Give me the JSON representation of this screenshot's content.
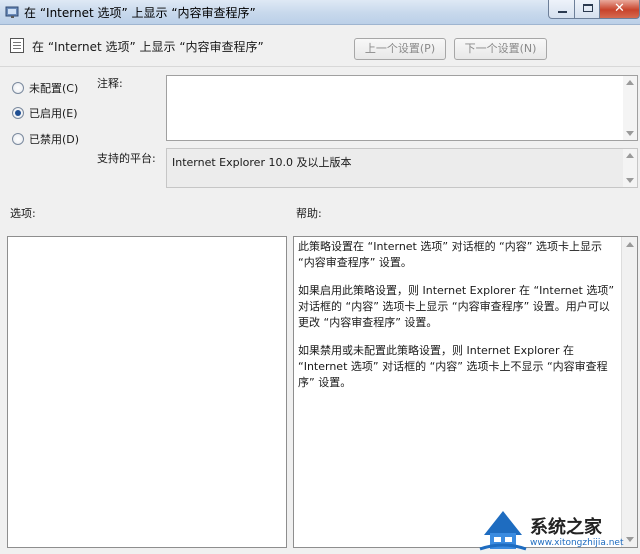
{
  "window": {
    "title": "在 “Internet 选项” 上显示 “内容审查程序”"
  },
  "header": {
    "setting_name": "在 “Internet 选项” 上显示 “内容审查程序”",
    "prev_button": "上一个设置(P)",
    "next_button": "下一个设置(N)"
  },
  "state": {
    "options": [
      {
        "label": "未配置(C)",
        "selected": false
      },
      {
        "label": "已启用(E)",
        "selected": true
      },
      {
        "label": "已禁用(D)",
        "selected": false
      }
    ]
  },
  "comment": {
    "label": "注释:",
    "value": ""
  },
  "platform": {
    "label": "支持的平台:",
    "value": "Internet Explorer 10.0 及以上版本"
  },
  "options_section": {
    "label": "选项:"
  },
  "help": {
    "label": "帮助:",
    "paragraphs": [
      "此策略设置在 “Internet 选项” 对话框的 “内容” 选项卡上显示 “内容审查程序” 设置。",
      "如果启用此策略设置，则 Internet Explorer 在 “Internet 选项” 对话框的 “内容” 选项卡上显示 “内容审查程序” 设置。用户可以更改 “内容审查程序” 设置。",
      "如果禁用或未配置此策略设置，则 Internet Explorer 在 “Internet 选项” 对话框的 “内容” 选项卡上不显示 “内容审查程序” 设置。"
    ]
  },
  "watermark": {
    "text": "系统之家",
    "url": "www.xitongzhijia.net"
  },
  "colors": {
    "titlebar": "#c7d8ec",
    "close_button": "#c8432b",
    "radio_selected": "#1f4e92",
    "watermark_blue": "#1e6cc0"
  },
  "icons": [
    "policy-window-icon",
    "policy-setting-icon",
    "minimize-icon",
    "maximize-icon",
    "close-icon",
    "watermark-logo-icon"
  ]
}
